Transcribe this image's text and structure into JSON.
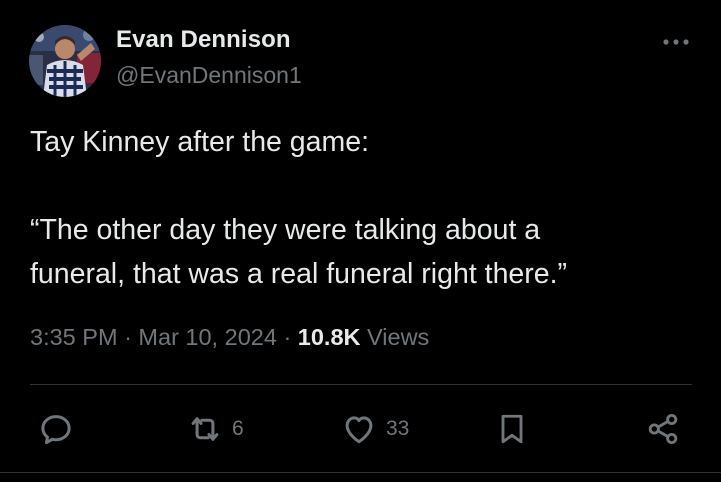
{
  "author": {
    "display_name": "Evan Dennison",
    "handle": "@EvanDennison1"
  },
  "tweet": {
    "line1": "Tay Kinney after the game:",
    "line2": "“The other day they were talking about a",
    "line3": "funeral, that was a real funeral right there.”"
  },
  "meta": {
    "time": "3:35 PM",
    "separator": "·",
    "date": "Mar 10, 2024",
    "views_count": "10.8K",
    "views_label": "Views"
  },
  "actions": {
    "reply_count": "",
    "retweet_count": "6",
    "like_count": "33"
  },
  "icons": [
    "more-icon",
    "reply-icon",
    "retweet-icon",
    "like-icon",
    "bookmark-icon",
    "share-icon"
  ],
  "colors": {
    "background": "#000000",
    "primary_text": "#e7e9ea",
    "secondary_text": "#71767b",
    "divider": "#2f3336"
  }
}
